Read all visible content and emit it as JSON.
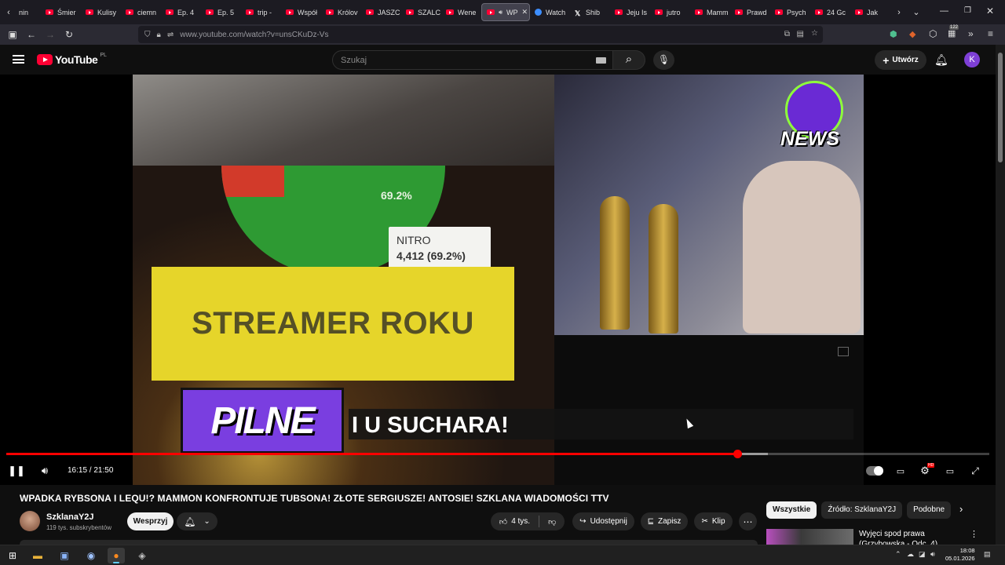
{
  "browser": {
    "tabs": [
      {
        "label": "Śmier"
      },
      {
        "label": "Kulisy"
      },
      {
        "label": "ciemn"
      },
      {
        "label": "Ep. 4"
      },
      {
        "label": "Ep. 5"
      },
      {
        "label": "trip -"
      },
      {
        "label": "Współ"
      },
      {
        "label": "Królov"
      },
      {
        "label": "JASZC"
      },
      {
        "label": "SZALC"
      },
      {
        "label": "Wene"
      },
      {
        "label": "WP"
      },
      {
        "label": "Watch"
      },
      {
        "label": "Shib"
      },
      {
        "label": "Jeju Is"
      },
      {
        "label": "jutro"
      },
      {
        "label": "Mamm"
      },
      {
        "label": "Prawd"
      },
      {
        "label": "Psych"
      },
      {
        "label": "24 Gc"
      },
      {
        "label": "Jak"
      }
    ],
    "first_tab_partial": "nin",
    "url": "www.youtube.com/watch?v=unsCKuDz-Vs",
    "extensions_badge": "122"
  },
  "youtube": {
    "logo_text": "YouTube",
    "region": "PL",
    "search_placeholder": "Szukaj",
    "create_label": "Utwórz",
    "avatar_letter": "K"
  },
  "video": {
    "overlay": {
      "pie_percent": "69.2%",
      "tooltip_name": "NITRO",
      "tooltip_value": "4,412 (69.2%)",
      "streamer_banner": "STREAMER ROKU",
      "pilne": "PILNE",
      "ticker": "I U SUCHARA!",
      "news_logo": "NEWS"
    },
    "time_current": "16:15",
    "time_total": "21:50",
    "time_display": "16:15 / 21:50",
    "progress_fraction": 0.744
  },
  "info": {
    "title": "WPADKA RYBSONA I LEQU!? MAMMON KONFRONTUJE TUBSONA! ZŁOTE SERGIUSZE! ANTOSIE! SZKLANA WIADOMOŚCI TTV",
    "channel_name": "SzklanaY2J",
    "subscribers": "119 tys. subskrybentów",
    "support_label": "Wesprzyj",
    "likes": "4 tys.",
    "share_label": "Udostępnij",
    "save_label": "Zapisz",
    "clip_label": "Klip"
  },
  "sidebar": {
    "chips": [
      "Wszystkie",
      "Źródło: SzklanaY2J",
      "Podobne"
    ],
    "active_chip": 0,
    "recommended": [
      {
        "title": "Wyjęci spod prawa (Grzybowska - Odc. 4)"
      }
    ]
  },
  "taskbar": {
    "time": "18:08",
    "date": "05.01.2026"
  }
}
